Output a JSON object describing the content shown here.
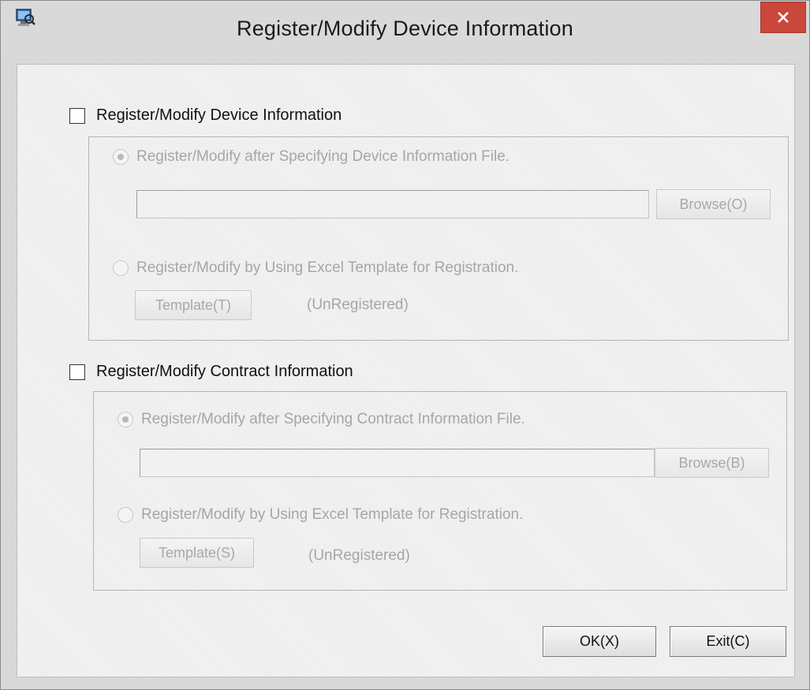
{
  "window": {
    "title": "Register/Modify Device Information",
    "close_glyph": "✕"
  },
  "device_section": {
    "checkbox_label": "Register/Modify Device Information",
    "checked": false,
    "option_file_label": "Register/Modify after Specifying Device Information File.",
    "file_path_value": "",
    "browse_label": "Browse(O)",
    "option_template_label": "Register/Modify by Using Excel Template for Registration.",
    "template_label": "Template(T)",
    "template_status": "(UnRegistered)"
  },
  "contract_section": {
    "checkbox_label": "Register/Modify Contract Information",
    "checked": false,
    "option_file_label": "Register/Modify after Specifying Contract Information File.",
    "file_path_value": "",
    "browse_label": "Browse(B)",
    "option_template_label": "Register/Modify by Using Excel Template for Registration.",
    "template_label": "Template(S)",
    "template_status": "(UnRegistered)"
  },
  "footer": {
    "ok_label": "OK(X)",
    "exit_label": "Exit(C)"
  },
  "colors": {
    "close_button": "#c9483b",
    "disabled_text": "#a6a6a6"
  },
  "icons": {
    "app": "computer-with-magnifier-icon",
    "close": "close-icon"
  }
}
